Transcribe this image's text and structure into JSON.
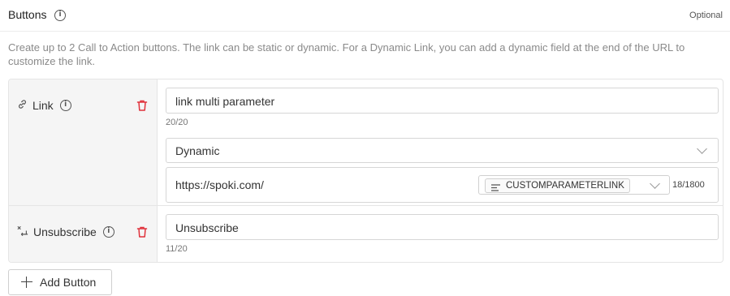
{
  "header": {
    "title": "Buttons",
    "optional_label": "Optional"
  },
  "description": "Create up to 2 Call to Action buttons. The link can be static or dynamic. For a Dynamic Link, you can add a dynamic field at the end of the URL to customize the link.",
  "buttons": [
    {
      "type_label": "Link",
      "type_icon": "link-icon",
      "text_value": "link multi parameter",
      "text_counter": "20/20",
      "link_mode": "Dynamic",
      "url_value": "https://spoki.com/",
      "dynamic_field": "CUSTOMPARAMETERLINK",
      "url_counter": "18/1800"
    },
    {
      "type_label": "Unsubscribe",
      "type_icon": "unsubscribe-icon",
      "text_value": "Unsubscribe",
      "text_counter": "11/20"
    }
  ],
  "add_button_label": "Add Button",
  "colors": {
    "delete": "#e0313b",
    "border": "#d6d6d6",
    "label_column_bg": "#f5f5f5"
  }
}
